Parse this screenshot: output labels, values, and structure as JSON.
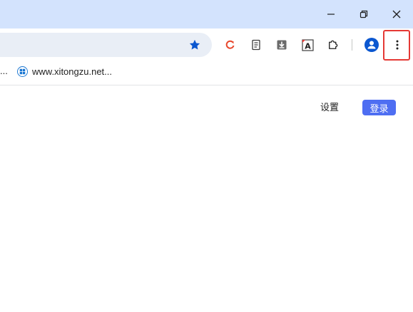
{
  "window_controls": {
    "minimize_icon": "minimize-icon",
    "restore_icon": "restore-icon",
    "close_icon": "close-icon"
  },
  "toolbar": {
    "bookmark_star_icon": "star-icon",
    "extensions": [
      {
        "name": "refresh-extension-icon"
      },
      {
        "name": "reader-icon"
      },
      {
        "name": "download-icon"
      },
      {
        "name": "translate-icon"
      },
      {
        "name": "puzzle-icon"
      }
    ],
    "profile_icon": "profile-icon",
    "menu_icon": "more-vert-icon"
  },
  "bookmarks_bar": {
    "overflow_label": "...",
    "items": [
      {
        "label": "www.xitongzu.net...",
        "icon": "windows-logo-icon"
      }
    ]
  },
  "page": {
    "settings_label": "设置",
    "login_label": "登录"
  },
  "colors": {
    "titlebar": "#d3e3fd",
    "omnibox": "#e9eef6",
    "star": "#0b57d0",
    "login_button": "#4e6ef2",
    "highlight": "#e53935"
  }
}
